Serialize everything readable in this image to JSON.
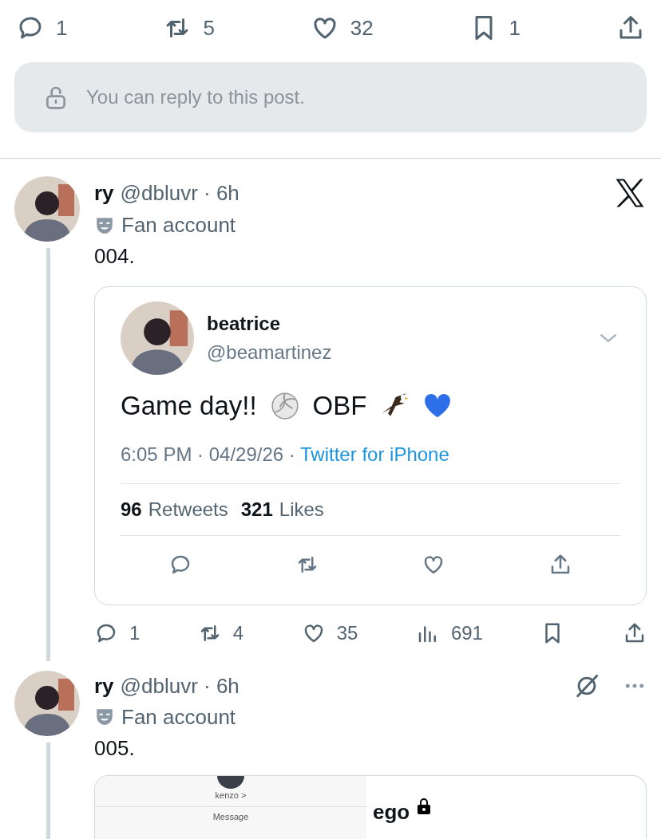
{
  "top_actions": [
    {
      "kind": "reply",
      "count": "1"
    },
    {
      "kind": "repost",
      "count": "5"
    },
    {
      "kind": "like",
      "count": "32"
    },
    {
      "kind": "bookmark",
      "count": "1"
    },
    {
      "kind": "share"
    }
  ],
  "reply_notice": "You can reply to this post.",
  "posts": [
    {
      "name": "ry",
      "handle_time": "@dbluvr · 6h",
      "label": "Fan account",
      "text": "004.",
      "corner": [
        {
          "kind": "x-logo"
        }
      ],
      "quote": {
        "name": "beatrice",
        "handle": "@beamartinez",
        "parts": [
          {
            "kind": "text",
            "text": "Game day!!"
          },
          {
            "kind": "volleyball"
          },
          {
            "kind": "text",
            "text": "OBF"
          },
          {
            "kind": "eagle"
          },
          {
            "kind": "heart"
          }
        ],
        "meta": "6:05 PM · 04/29/26 · ",
        "source": "Twitter for iPhone",
        "stats": [
          {
            "count": "96",
            "label": "Retweets"
          },
          {
            "count": "321",
            "label": "Likes"
          }
        ],
        "actions": [
          {
            "kind": "reply"
          },
          {
            "kind": "repost"
          },
          {
            "kind": "like"
          },
          {
            "kind": "share"
          }
        ]
      },
      "actions": [
        {
          "kind": "reply",
          "count": "1"
        },
        {
          "kind": "repost",
          "count": "4"
        },
        {
          "kind": "like",
          "count": "35"
        },
        {
          "kind": "views",
          "count": "691"
        },
        {
          "kind": "bookmark"
        },
        {
          "kind": "share"
        }
      ]
    },
    {
      "name": "ry",
      "handle_time": "@dbluvr · 6h",
      "label": "Fan account",
      "text": "005.",
      "corner": [
        {
          "kind": "grok"
        },
        {
          "kind": "more"
        }
      ],
      "media": {
        "contact": "kenzo >",
        "field": "Message",
        "title": "ego"
      }
    }
  ]
}
